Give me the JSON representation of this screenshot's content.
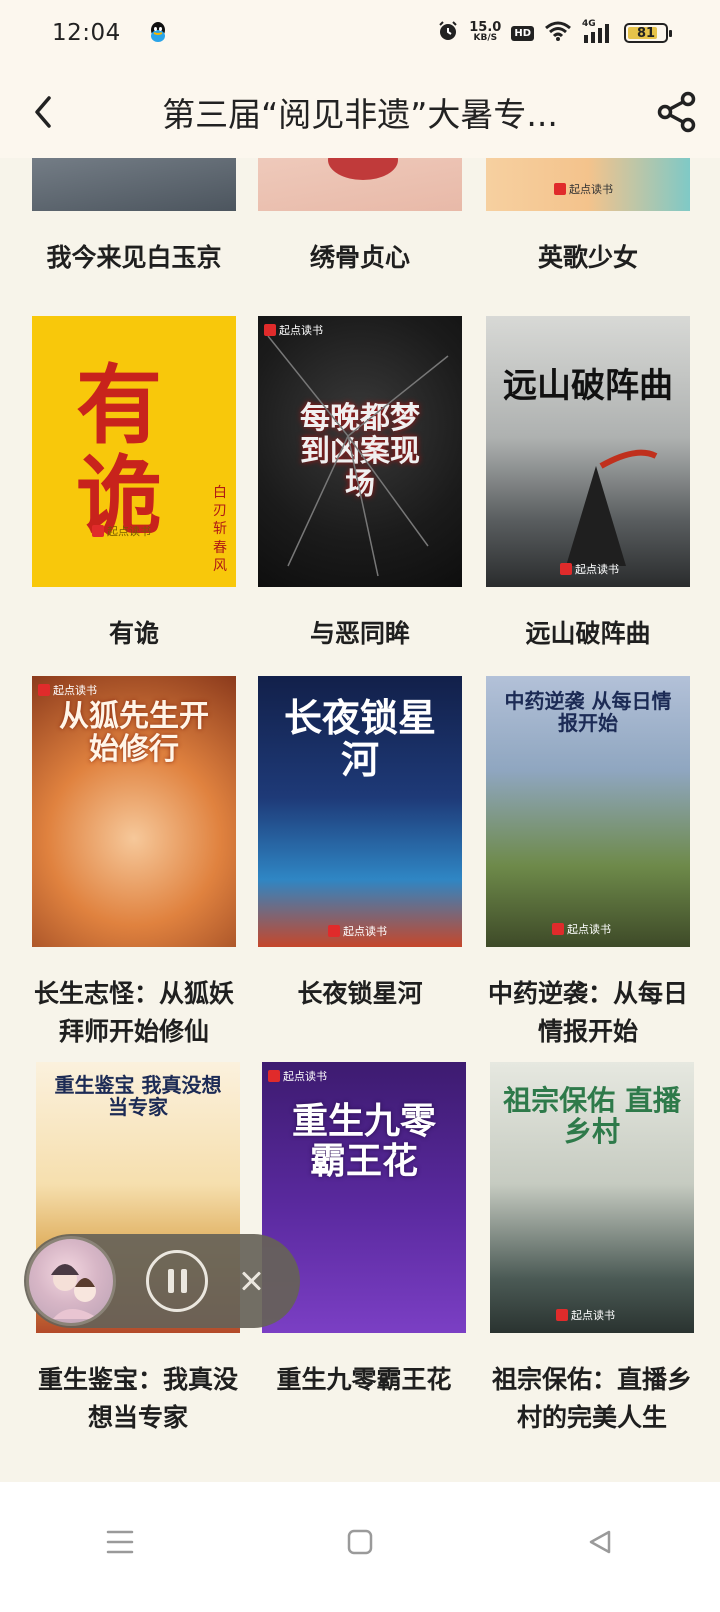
{
  "status_bar": {
    "time": "12:04",
    "net_speed_value": "15.0",
    "net_speed_unit": "KB/S",
    "hd": "HD",
    "network": "4G",
    "battery": "81",
    "battery_level": 0.81
  },
  "nav": {
    "title": "第三届“阅见非遗”大暑专..."
  },
  "books": [
    {
      "title": "我今来见白玉京",
      "cover_colors": [
        "#5c6470",
        "#a9b1b8"
      ]
    },
    {
      "title": "绣骨贞心",
      "cover_colors": [
        "#f1d4c8",
        "#c04a4a"
      ]
    },
    {
      "title": "英歌少女",
      "cover_colors": [
        "#f3c79a",
        "#7ec5c5"
      ],
      "cover_logo": "起点读书"
    },
    {
      "title": "有诡",
      "cover_colors": [
        "#f7c90a",
        "#f2b800"
      ],
      "cover_text": "有诡",
      "cover_author": "白刃斩春风",
      "cover_logo": "起点读书"
    },
    {
      "title": "与恶同眸",
      "cover_colors": [
        "#1a1a1a",
        "#3a3a3a"
      ],
      "cover_text": "每晚都梦到凶案现场",
      "cover_logo": "起点读书"
    },
    {
      "title": "远山破阵曲",
      "cover_colors": [
        "#c9cccd",
        "#4a4f52"
      ],
      "cover_text": "远山破阵曲",
      "cover_logo": "起点读书"
    },
    {
      "title": "长生志怪：从狐妖拜师开始修仙",
      "cover_colors": [
        "#d9783d",
        "#f1e2c9"
      ],
      "cover_text": "从狐先生开始修行",
      "cover_logo": "起点读书"
    },
    {
      "title": "长夜锁星河",
      "cover_colors": [
        "#1c2d5c",
        "#2f8fc8"
      ],
      "cover_text": "长夜锁星河",
      "cover_logo": "起点读书"
    },
    {
      "title": "中药逆袭：从每日情报开始",
      "cover_colors": [
        "#9fb0c9",
        "#5a6e3a"
      ],
      "cover_text": "中药逆袭 从每日情报开始",
      "cover_logo": "起点读书"
    },
    {
      "title": "重生鉴宝：我真没想当专家",
      "cover_colors": [
        "#f6e6c8",
        "#d9a24a"
      ],
      "cover_text": "重生鉴宝 我真没想当专家"
    },
    {
      "title": "重生九零霸王花",
      "cover_colors": [
        "#3a1a6b",
        "#6a36b0"
      ],
      "cover_text": "重生九零霸王花",
      "cover_logo": "起点读书"
    },
    {
      "title": "祖宗保佑：直播乡村的完美人生",
      "cover_colors": [
        "#d9dcd2",
        "#3a4a44"
      ],
      "cover_text": "祖宗保佑 直播乡村",
      "cover_logo": "起点读书"
    }
  ],
  "icons": {
    "back": "chevron-left-icon",
    "share": "share-icon",
    "pause": "pause-icon",
    "close": "close-icon",
    "menu": "menu-icon",
    "home": "home-icon",
    "recent": "back-triangle-icon"
  }
}
